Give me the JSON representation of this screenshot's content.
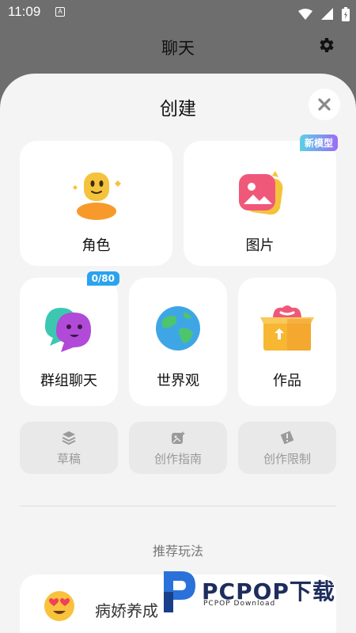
{
  "status_bar": {
    "time": "11:09",
    "notification_glyph": "A"
  },
  "header": {
    "title": "聊天"
  },
  "sheet": {
    "title": "创建"
  },
  "cards": {
    "role": {
      "label": "角色"
    },
    "image": {
      "label": "图片",
      "badge": "新模型"
    },
    "group_chat": {
      "label": "群组聊天",
      "badge": "0/80"
    },
    "worldview": {
      "label": "世界观"
    },
    "works": {
      "label": "作品"
    }
  },
  "tools": {
    "draft": {
      "label": "草稿",
      "icon": "layers-icon"
    },
    "guide": {
      "label": "创作指南",
      "icon": "guide-icon"
    },
    "limits": {
      "label": "创作限制",
      "icon": "warning-icon"
    }
  },
  "recommend": {
    "section_title": "推荐玩法",
    "items": [
      {
        "label": "病娇养成",
        "icon": "heart-eyes-emoji-icon"
      }
    ]
  },
  "watermark": {
    "text": "PCPOP下载",
    "sub": "PCPOP Download"
  },
  "colors": {
    "sheet_bg": "#f4f4f4",
    "backdrop": "#6e6e6e",
    "badge_new": "#7aa6f0",
    "badge_count": "#29a3ef"
  }
}
